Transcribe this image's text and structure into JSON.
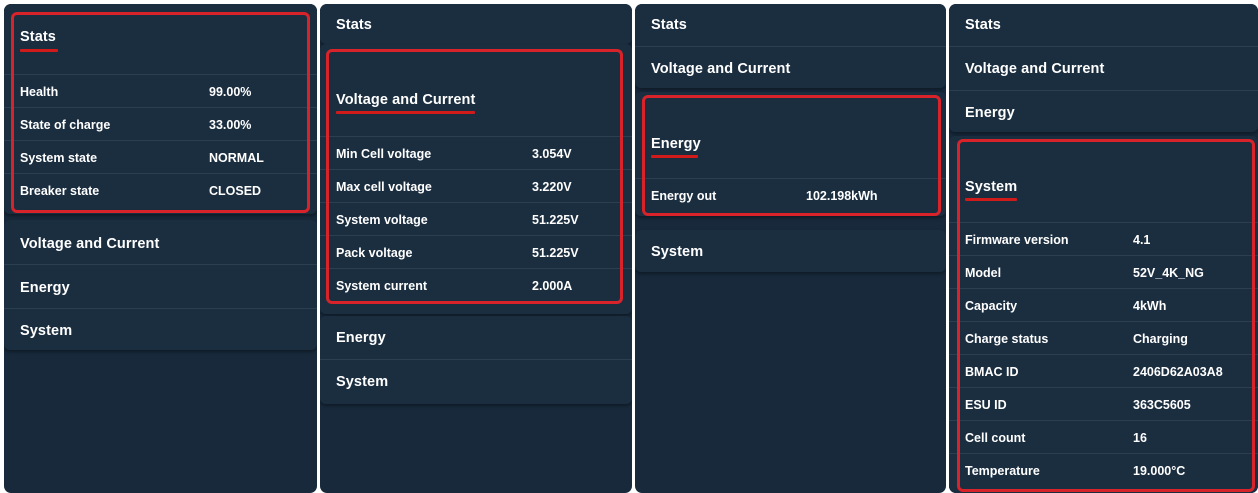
{
  "panels": [
    {
      "stats_title": "Stats",
      "stats_items": [
        {
          "label": "Health",
          "value": "99.00%"
        },
        {
          "label": "State of charge",
          "value": "33.00%"
        },
        {
          "label": "System state",
          "value": "NORMAL"
        },
        {
          "label": "Breaker state",
          "value": "CLOSED"
        }
      ],
      "voltage_title": "Voltage and Current",
      "energy_title": "Energy",
      "system_title": "System"
    },
    {
      "stats_title": "Stats",
      "voltage_title": "Voltage and Current",
      "voltage_items": [
        {
          "label": "Min Cell voltage",
          "value": "3.054V"
        },
        {
          "label": "Max cell voltage",
          "value": "3.220V"
        },
        {
          "label": "System voltage",
          "value": "51.225V"
        },
        {
          "label": "Pack voltage",
          "value": "51.225V"
        },
        {
          "label": "System current",
          "value": "2.000A"
        }
      ],
      "energy_title": "Energy",
      "system_title": "System"
    },
    {
      "stats_title": "Stats",
      "voltage_title": "Voltage and Current",
      "energy_title": "Energy",
      "energy_items": [
        {
          "label": "Energy out",
          "value": "102.198kWh"
        }
      ],
      "system_title": "System"
    },
    {
      "stats_title": "Stats",
      "voltage_title": "Voltage and Current",
      "energy_title": "Energy",
      "system_title": "System",
      "system_items": [
        {
          "label": "Firmware version",
          "value": "4.1"
        },
        {
          "label": "Model",
          "value": "52V_4K_NG"
        },
        {
          "label": "Capacity",
          "value": "4kWh"
        },
        {
          "label": "Charge status",
          "value": "Charging"
        },
        {
          "label": "BMAC ID",
          "value": "2406D62A03A8"
        },
        {
          "label": "ESU ID",
          "value": "363C5605"
        },
        {
          "label": "Cell count",
          "value": "16"
        },
        {
          "label": "Temperature",
          "value": "19.000°C"
        }
      ]
    }
  ],
  "colors": {
    "panel_bg": "#17293b",
    "highlight_border": "#d8232a",
    "underline": "#d11a1a"
  }
}
